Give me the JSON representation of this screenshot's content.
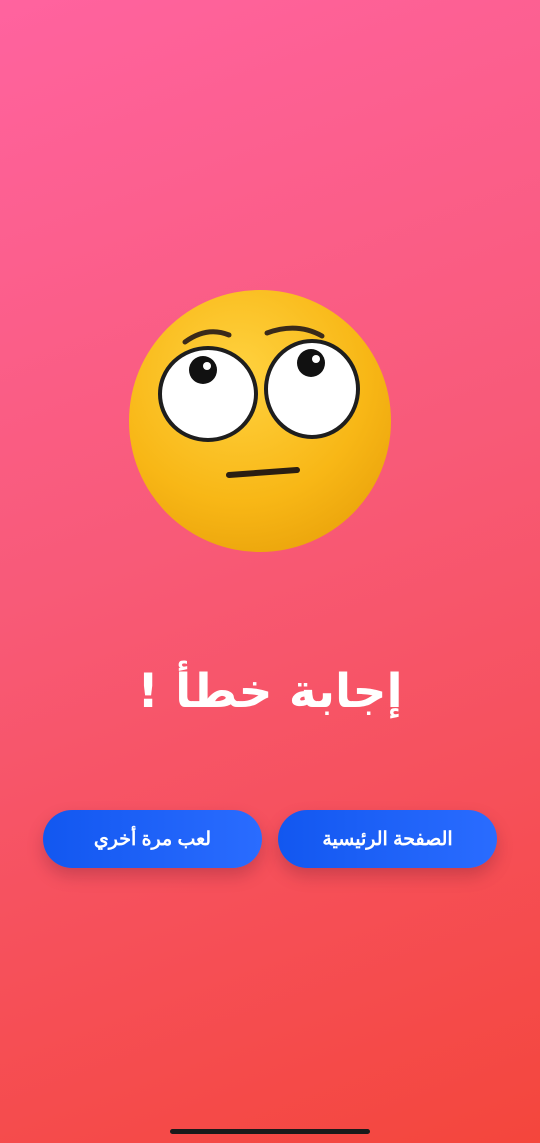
{
  "result": {
    "title": "إجابة خطأ !",
    "emoji": "face-with-rolling-eyes-icon"
  },
  "buttons": {
    "home_label": "الصفحة الرئيسية",
    "replay_label": "لعب مرة أخري",
    "color": "#1a5ff5"
  },
  "colors": {
    "background_top": "#ff639f",
    "background_bottom": "#f4463c"
  }
}
